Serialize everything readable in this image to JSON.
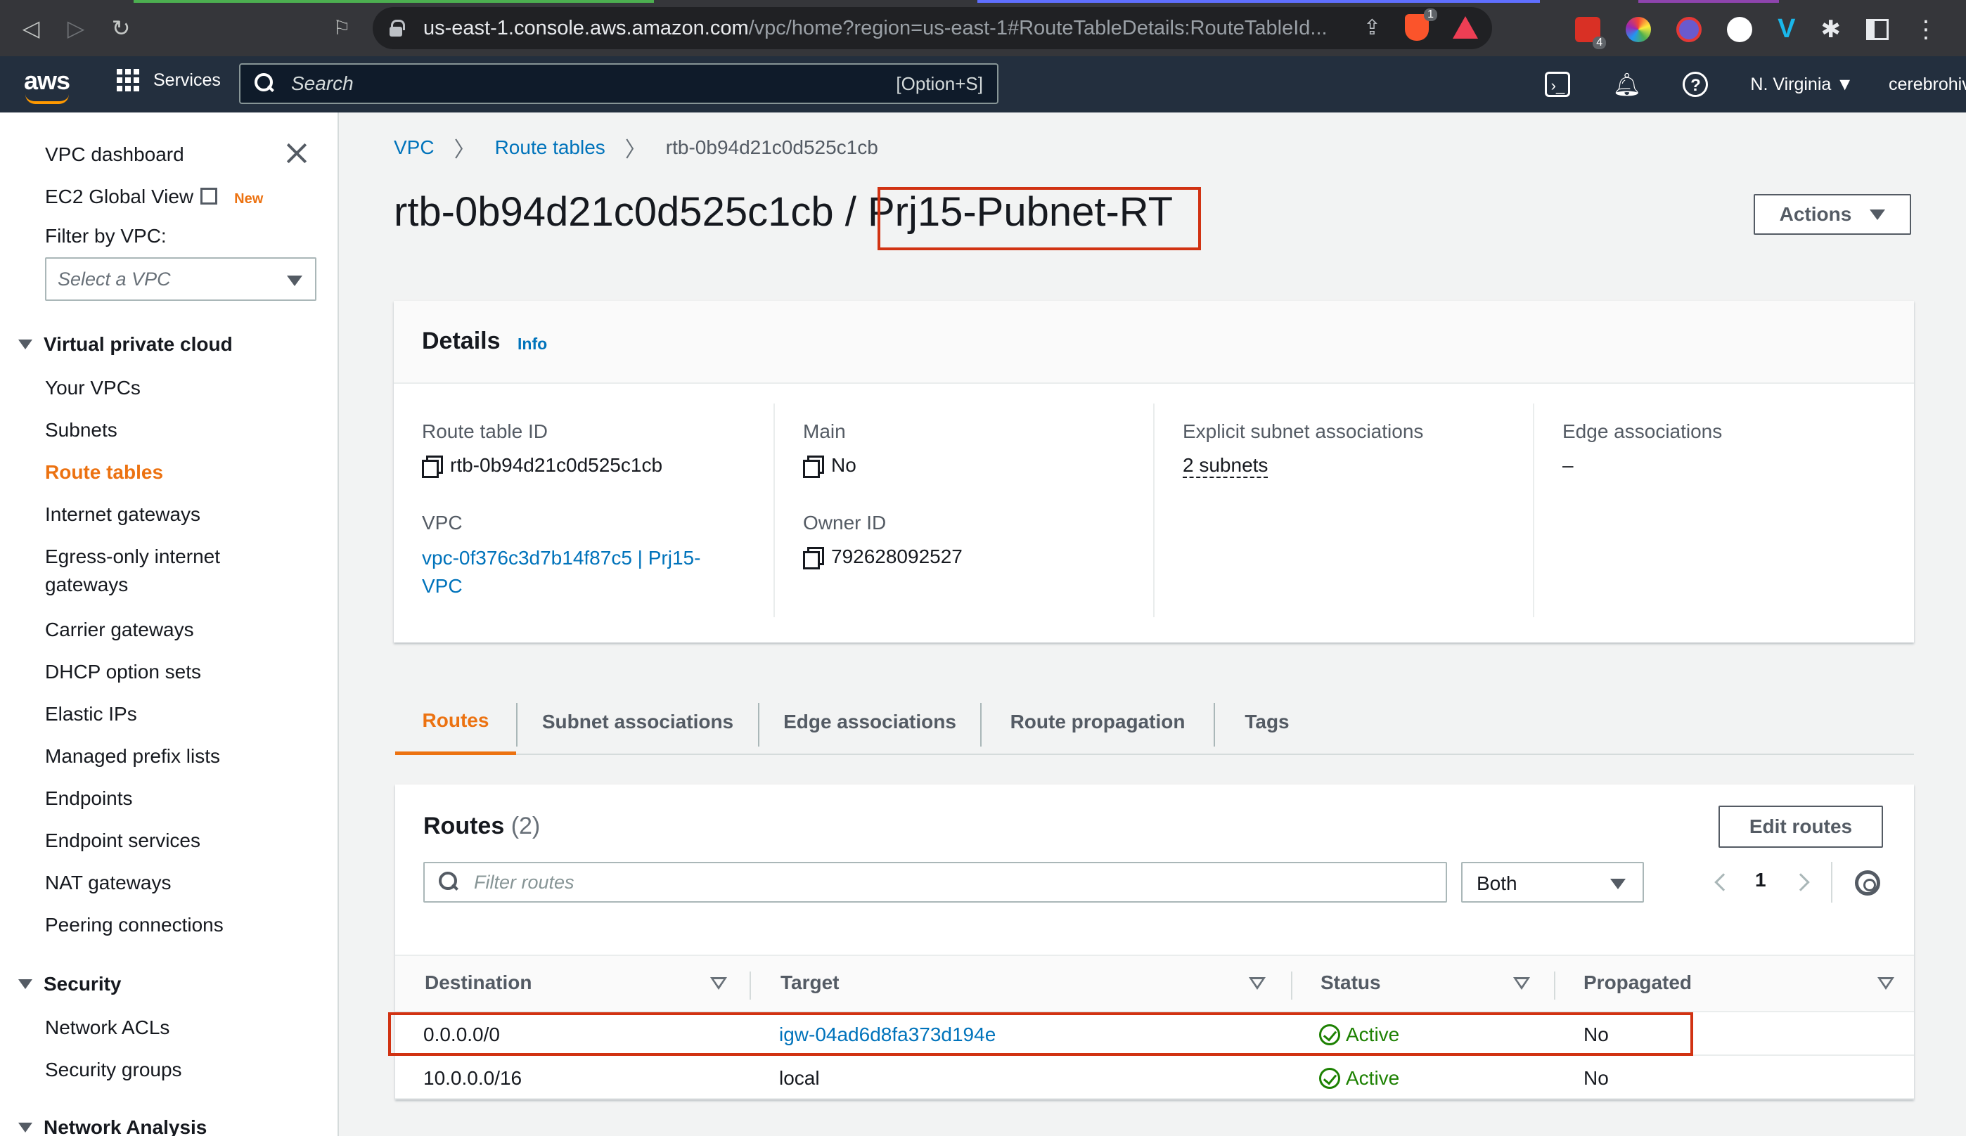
{
  "browser": {
    "url_host": "us-east-1.console.aws.amazon.com",
    "url_path": "/vpc/home?region=us-east-1#RouteTableDetails:RouteTableId...",
    "badge_brave": "1",
    "badge_ext": "4"
  },
  "aws_nav": {
    "logo": "aws",
    "services_label": "Services",
    "search_placeholder": "Search",
    "search_shortcut": "[Option+S]",
    "region": "N. Virginia",
    "account": "cerebrohiv"
  },
  "sidebar": {
    "dashboard": "VPC dashboard",
    "ec2_global_view": "EC2 Global View",
    "new_badge": "New",
    "filter_label": "Filter by VPC:",
    "filter_placeholder": "Select a VPC",
    "section_vpc": "Virtual private cloud",
    "vpc_items": [
      "Your VPCs",
      "Subnets",
      "Route tables",
      "Internet gateways",
      "Egress-only internet",
      "gateways",
      "Carrier gateways",
      "DHCP option sets",
      "Elastic IPs",
      "Managed prefix lists",
      "Endpoints",
      "Endpoint services",
      "NAT gateways",
      "Peering connections"
    ],
    "active_item": "Route tables",
    "section_security": "Security",
    "security_items": [
      "Network ACLs",
      "Security groups"
    ],
    "section_network_analysis": "Network Analysis"
  },
  "breadcrumb": {
    "items": [
      "VPC",
      "Route tables",
      "rtb-0b94d21c0d525c1cb"
    ]
  },
  "page": {
    "title_id": "rtb-0b94d21c0d525c1cb /",
    "title_name": "Prj15-Pubnet-RT",
    "actions_label": "Actions"
  },
  "details": {
    "heading": "Details",
    "info": "Info",
    "route_table_id_label": "Route table ID",
    "route_table_id": "rtb-0b94d21c0d525c1cb",
    "vpc_label": "VPC",
    "vpc_value_line1": "vpc-0f376c3d7b14f87c5 | Prj15-",
    "vpc_value_line2": "VPC",
    "main_label": "Main",
    "main_value": "No",
    "owner_label": "Owner ID",
    "owner_value": "792628092527",
    "explicit_label": "Explicit subnet associations",
    "explicit_value": "2 subnets",
    "edge_label": "Edge associations",
    "edge_value": "–"
  },
  "tabs": [
    "Routes",
    "Subnet associations",
    "Edge associations",
    "Route propagation",
    "Tags"
  ],
  "routes": {
    "heading": "Routes",
    "count": "(2)",
    "edit_label": "Edit routes",
    "filter_placeholder": "Filter routes",
    "select_value": "Both",
    "page": "1",
    "columns": [
      "Destination",
      "Target",
      "Status",
      "Propagated"
    ],
    "rows": [
      {
        "destination": "0.0.0.0/0",
        "target": "igw-04ad6d8fa373d194e",
        "status": "Active",
        "propagated": "No"
      },
      {
        "destination": "10.0.0.0/16",
        "target": "local",
        "status": "Active",
        "propagated": "No"
      }
    ]
  },
  "colors": {
    "aws_nav": "#232f3e",
    "accent_orange": "#ec7211",
    "link_blue": "#0073bb",
    "success_green": "#1d8102",
    "highlight_red": "#d13212"
  }
}
